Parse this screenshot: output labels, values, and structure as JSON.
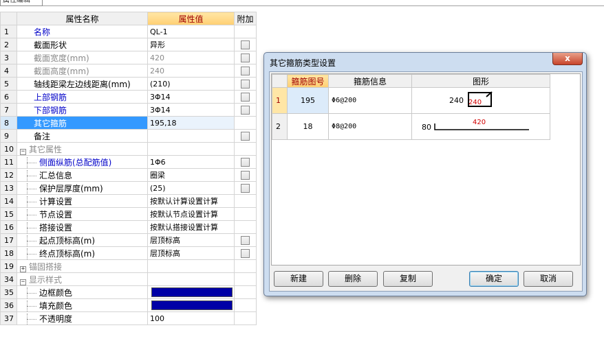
{
  "window": {
    "tab_label": "属性编辑"
  },
  "grid": {
    "headers": {
      "name": "属性名称",
      "value": "属性值",
      "extra": "附加"
    },
    "rows": [
      {
        "num": "1",
        "name": "名称",
        "value": "QL-1"
      },
      {
        "num": "2",
        "name": "截面形状",
        "value": "异形"
      },
      {
        "num": "3",
        "name": "截面宽度(mm)",
        "value": "420"
      },
      {
        "num": "4",
        "name": "截面高度(mm)",
        "value": "240"
      },
      {
        "num": "5",
        "name": "轴线距梁左边线距离(mm)",
        "value": "(210)"
      },
      {
        "num": "6",
        "name": "上部钢筋",
        "value": "3Φ14"
      },
      {
        "num": "7",
        "name": "下部钢筋",
        "value": "3Φ14"
      },
      {
        "num": "8",
        "name": "其它箍筋",
        "value": "195,18"
      },
      {
        "num": "9",
        "name": "备注",
        "value": ""
      },
      {
        "num": "10",
        "name": "其它属性",
        "value": ""
      },
      {
        "num": "11",
        "name": "侧面纵筋(总配筋值)",
        "value": "1Φ6"
      },
      {
        "num": "12",
        "name": "汇总信息",
        "value": "圈梁"
      },
      {
        "num": "13",
        "name": "保护层厚度(mm)",
        "value": "(25)"
      },
      {
        "num": "14",
        "name": "计算设置",
        "value": "按默认计算设置计算"
      },
      {
        "num": "15",
        "name": "节点设置",
        "value": "按默认节点设置计算"
      },
      {
        "num": "16",
        "name": "搭接设置",
        "value": "按默认搭接设置计算"
      },
      {
        "num": "17",
        "name": "起点顶标高(m)",
        "value": "层顶标高"
      },
      {
        "num": "18",
        "name": "终点顶标高(m)",
        "value": "层顶标高"
      },
      {
        "num": "19",
        "name": "锚固搭接",
        "value": ""
      },
      {
        "num": "34",
        "name": "显示样式",
        "value": ""
      },
      {
        "num": "35",
        "name": "边框颜色",
        "value": ""
      },
      {
        "num": "36",
        "name": "填充颜色",
        "value": ""
      },
      {
        "num": "37",
        "name": "不透明度",
        "value": "100"
      }
    ],
    "colors": {
      "border_color": "#0000a6",
      "fill_color": "#0000a6"
    }
  },
  "dialog": {
    "title": "其它箍筋类型设置",
    "close_label": "x",
    "headers": {
      "code": "箍筋图号",
      "info": "箍筋信息",
      "shape": "图形"
    },
    "rows": [
      {
        "num": "1",
        "code": "195",
        "info": "Φ6@200",
        "dim_left": "240",
        "dim_inner": "240"
      },
      {
        "num": "2",
        "code": "18",
        "info": "Φ8@200",
        "dim_left": "80",
        "dim_top": "420"
      }
    ],
    "buttons": {
      "new": "新建",
      "delete": "删除",
      "copy": "复制",
      "ok": "确定",
      "cancel": "取消"
    }
  }
}
